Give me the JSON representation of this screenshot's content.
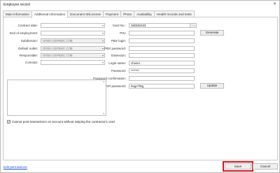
{
  "window": {
    "title": "Employee record"
  },
  "tabs": [
    {
      "label": "Main information"
    },
    {
      "label": "Additional information"
    },
    {
      "label": "Document ID/License"
    },
    {
      "label": "Payment"
    },
    {
      "label": "Photo"
    },
    {
      "label": "Availability"
    },
    {
      "label": "Health records and tests"
    }
  ],
  "left_form": {
    "contract_date": {
      "label": "Contract date:",
      "value": ""
    },
    "end_of_employment": {
      "label": "End of employment:",
      "value": ""
    },
    "subdivision": {
      "label": "Subdivision:",
      "value": "ОПЕН СЕРВИС СПБ"
    },
    "default_outlet": {
      "label": "Default outlet:",
      "value": "ОПЕН СЕРВИС СПБ"
    },
    "responsible": {
      "label": "Responsible:",
      "value": "ОПЕН СЕРВИС СПБ"
    },
    "concept": {
      "label": "Concept:",
      "value": ""
    }
  },
  "right_form": {
    "card_no": {
      "label": "Card No.:",
      "value": "36DDE633",
      "button": "..."
    },
    "pin": {
      "label": "PIN:",
      "value": "",
      "button": "Generate"
    },
    "pbx_login": {
      "label": "PBX login:",
      "value": ""
    },
    "pbx_password": {
      "label": "PBX password:",
      "value": ""
    },
    "extension": {
      "label": "Extension:",
      "value": ""
    },
    "login_name": {
      "label": "Login name:",
      "value": "chuser"
    },
    "password": {
      "label": "Password:",
      "value": "*******"
    },
    "password_confirmation": {
      "label": "Password confirmation:",
      "value": ""
    },
    "external_api_password": {
      "label": "External API password:",
      "value": "9ugz7t9g",
      "button": "Update"
    }
  },
  "checkbox": {
    "label": "Cannot post transactions on account without swiping the contractor's card",
    "checked": true,
    "mark": "✓"
  },
  "footer": {
    "edit_permissions": "Edit permissions",
    "save": "Save",
    "cancel": "Cancel"
  },
  "icons": {
    "close": "✕",
    "calendar": "▾",
    "dropdown": "▾",
    "scroll_up": "▲",
    "scroll_down": "▼"
  },
  "colors": {
    "highlight": "#d0191f",
    "link": "#1a4fd6"
  }
}
